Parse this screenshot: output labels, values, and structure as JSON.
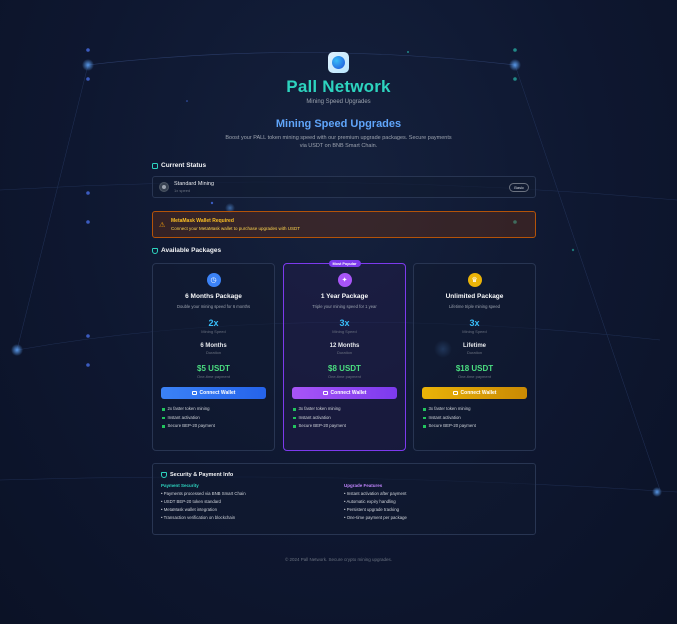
{
  "app": {
    "title": "Pall Network",
    "subtitle": "Mining Speed Upgrades"
  },
  "hero": {
    "heading": "Mining Speed Upgrades",
    "description": "Boost your PALL token mining speed with our premium upgrade packages. Secure payments via USDT on BNB Smart Chain."
  },
  "current_status": {
    "title": "Current Status",
    "plan": "Standard Mining",
    "speed": "1x speed",
    "badge": "Basic"
  },
  "warning": {
    "title": "MetaMask Wallet Required",
    "message": "Connect your MetaMask wallet to purchase upgrades with USDT"
  },
  "packages_title": "Available Packages",
  "packages": [
    {
      "name": "6 Months Package",
      "desc": "Double your mining speed for 6 months",
      "multiplier": "2x",
      "multiplier_caption": "Mining Speed",
      "duration": "6 Months",
      "duration_caption": "Duration",
      "price": "$5 USDT",
      "price_caption": "One-time payment",
      "button": "Connect Wallet",
      "icon": "clock-icon",
      "color": "#3b82f6",
      "features": [
        "2x faster token mining",
        "Instant activation",
        "Secure BEP-20 payment"
      ]
    },
    {
      "name": "1 Year Package",
      "desc": "Triple your mining speed for 1 year",
      "badge": "Most Popular",
      "multiplier": "3x",
      "multiplier_caption": "Mining Speed",
      "duration": "12 Months",
      "duration_caption": "Duration",
      "price": "$8 USDT",
      "price_caption": "One-time payment",
      "button": "Connect Wallet",
      "icon": "sparkle-icon",
      "color": "#a855f7",
      "features": [
        "3x faster token mining",
        "Instant activation",
        "Secure BEP-20 payment"
      ]
    },
    {
      "name": "Unlimited Package",
      "desc": "Lifetime triple mining speed",
      "multiplier": "3x",
      "multiplier_caption": "Mining Speed",
      "duration": "Lifetime",
      "duration_caption": "Duration",
      "price": "$18 USDT",
      "price_caption": "One-time payment",
      "button": "Connect Wallet",
      "icon": "crown-icon",
      "color": "#eab308",
      "features": [
        "3x faster token mining",
        "Instant activation",
        "Secure BEP-20 payment"
      ]
    }
  ],
  "security": {
    "title": "Security & Payment Info",
    "payment_heading": "Payment Security",
    "payment_items": [
      "Payments processed via BNB Smart Chain",
      "USDT BEP-20 token standard",
      "MetaMask wallet integration",
      "Transaction verification on blockchain"
    ],
    "upgrade_heading": "Upgrade Features",
    "upgrade_items": [
      "Instant activation after payment",
      "Automatic expiry handling",
      "Persistent upgrade tracking",
      "One-time payment per package"
    ]
  },
  "footer": "© 2024 Pall Network. Secure crypto mining upgrades.",
  "colors": {
    "accent_teal": "#2dd4bf",
    "accent_blue": "#60a5fa",
    "price_green": "#4ade80",
    "warning": "#f59e0b"
  }
}
